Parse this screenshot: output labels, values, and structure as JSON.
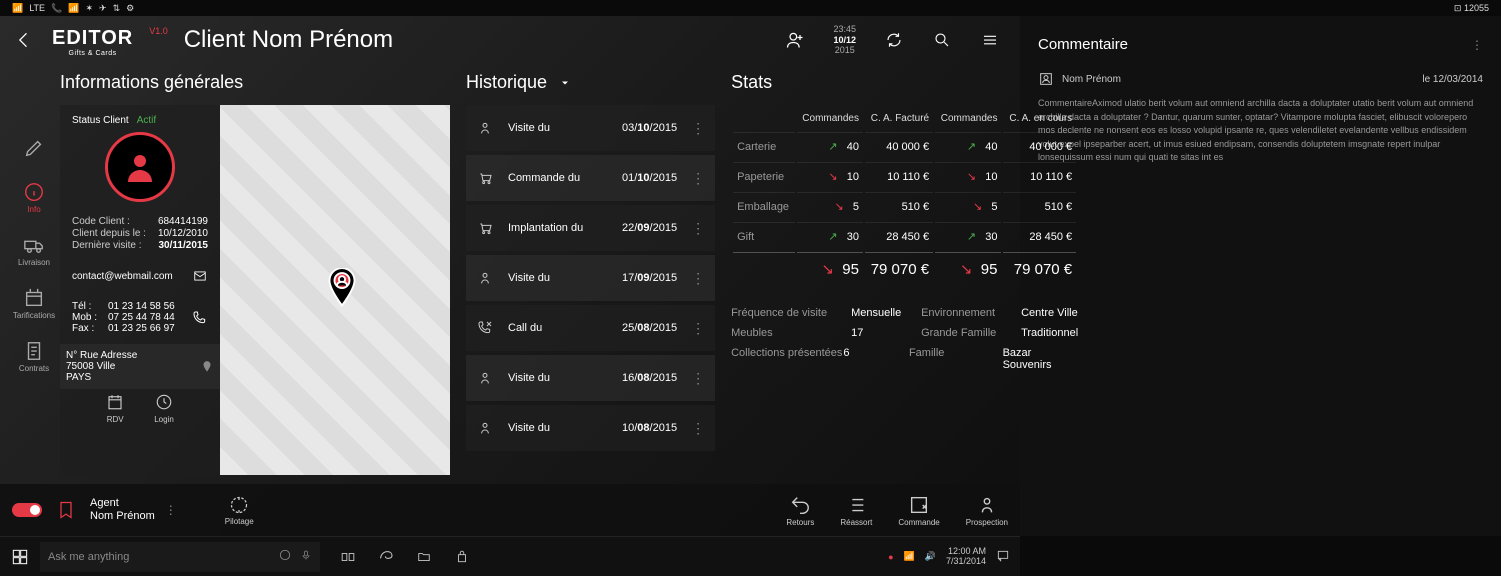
{
  "statusbar": {
    "left": [
      "📶",
      "LTE",
      "📞",
      "📶",
      "✶",
      "✈",
      "⇅",
      "⚙"
    ],
    "right": "⊡ 12055"
  },
  "header": {
    "logo": "EDITOR",
    "logo_sub": "Gifts & Cards",
    "version": "V1.0",
    "title": "Client Nom Prénom",
    "date": {
      "top": "23:45",
      "mid": "10/12",
      "bot": "2015"
    }
  },
  "sections": {
    "info": "Informations générales",
    "hist": "Historique",
    "stats": "Stats",
    "comment": "Commentaire"
  },
  "sidenav": [
    {
      "icon": "pencil",
      "label": ""
    },
    {
      "icon": "info",
      "label": "Info",
      "active": true
    },
    {
      "icon": "truck",
      "label": "Livraison"
    },
    {
      "icon": "tag",
      "label": "Tarifications"
    },
    {
      "icon": "doc",
      "label": "Contrats"
    }
  ],
  "client": {
    "status_label": "Status Client",
    "status_value": "Actif",
    "code_label": "Code Client :",
    "code": "684414199",
    "since_label": "Client depuis le :",
    "since": "10/12/2010",
    "last_label": "Dernière visite :",
    "last": "30/11/2015",
    "email": "contact@webmail.com",
    "tel_label": "Tél :",
    "tel": "01 23 14 58 56",
    "mob_label": "Mob :",
    "mob": "07 25 44 78 44",
    "fax_label": "Fax :",
    "fax": "01 23 25 66 97",
    "addr1": "N° Rue Adresse",
    "addr2": "75008 Ville",
    "addr3": "PAYS",
    "rdv": "RDV",
    "login": "Login"
  },
  "history": [
    {
      "icon": "person",
      "label": "Visite du",
      "date": "03/10/2015",
      "b": "10"
    },
    {
      "icon": "cart",
      "label": "Commande du",
      "date": "01/10/2015",
      "b": "10"
    },
    {
      "icon": "cart",
      "label": "Implantation du",
      "date": "22/09/2015",
      "b": "09"
    },
    {
      "icon": "person",
      "label": "Visite du",
      "date": "17/09/2015",
      "b": "09"
    },
    {
      "icon": "phone",
      "label": "Call du",
      "date": "25/08/2015",
      "b": "08"
    },
    {
      "icon": "person",
      "label": "Visite du",
      "date": "16/08/2015",
      "b": "08"
    },
    {
      "icon": "person",
      "label": "Visite du",
      "date": "10/08/2015",
      "b": "08"
    }
  ],
  "stats": {
    "headers": [
      "",
      "Commandes",
      "C. A. Facturé",
      "Commandes",
      "C. A. en cours"
    ],
    "rows": [
      {
        "cat": "Carterie",
        "d1": "up",
        "c1": "40",
        "f1": "40 000 €",
        "d2": "up",
        "c2": "40",
        "f2": "40 000 €"
      },
      {
        "cat": "Papeterie",
        "d1": "dn",
        "c1": "10",
        "f1": "10 110 €",
        "d2": "dn",
        "c2": "10",
        "f2": "10 110 €"
      },
      {
        "cat": "Emballage",
        "d1": "dn",
        "c1": "5",
        "f1": "510 €",
        "d2": "dn",
        "c2": "5",
        "f2": "510 €"
      },
      {
        "cat": "Gift",
        "d1": "up",
        "c1": "30",
        "f1": "28 450 €",
        "d2": "up",
        "c2": "30",
        "f2": "28 450 €"
      }
    ],
    "total": {
      "d1": "dn",
      "c1": "95",
      "f1": "79 070 €",
      "d2": "dn",
      "c2": "95",
      "f2": "79 070 €"
    },
    "kv": [
      {
        "k": "Fréquence de visite",
        "v": "Mensuelle",
        "k2": "Environnement",
        "v2": "Centre Ville"
      },
      {
        "k": "Meubles",
        "v": "17",
        "k2": "Grande Famille",
        "v2": "Traditionnel"
      },
      {
        "k": "Collections présentées",
        "v": "6",
        "k2": "Famille",
        "v2": "Bazar Souvenirs"
      }
    ]
  },
  "footer": {
    "agent_label": "Agent",
    "agent_name": "Nom Prénom",
    "pilotage": "Pilotage",
    "actions": [
      {
        "icon": "undo",
        "label": "Retours"
      },
      {
        "icon": "list",
        "label": "Réassort"
      },
      {
        "icon": "order",
        "label": "Commande"
      },
      {
        "icon": "person",
        "label": "Prospection"
      }
    ]
  },
  "comment": {
    "who": "Nom Prénom",
    "when": "le 12/03/2014",
    "body": "CommentaireAximod ulatio berit volum aut omniend archilla dacta a doluptater utatio berit volum aut omniend archilla dacta a doluptater ? Dantur, quarum sunter, optatar? Vitampore molupta fasciet, elibuscit volorepero mos declente ne nonsent eos es losso volupid ipsante re, ques velendiletet evelandente vellbus endissidem volut expel ipseparber acert, ut imus esiued endipsam, consendis doluptetem imsgnate repert inulpar lonsequissum essi num qui quati te sitas int es"
  },
  "taskbar": {
    "search_placeholder": "Ask me anything",
    "time": "12:00 AM",
    "date": "7/31/2014"
  }
}
